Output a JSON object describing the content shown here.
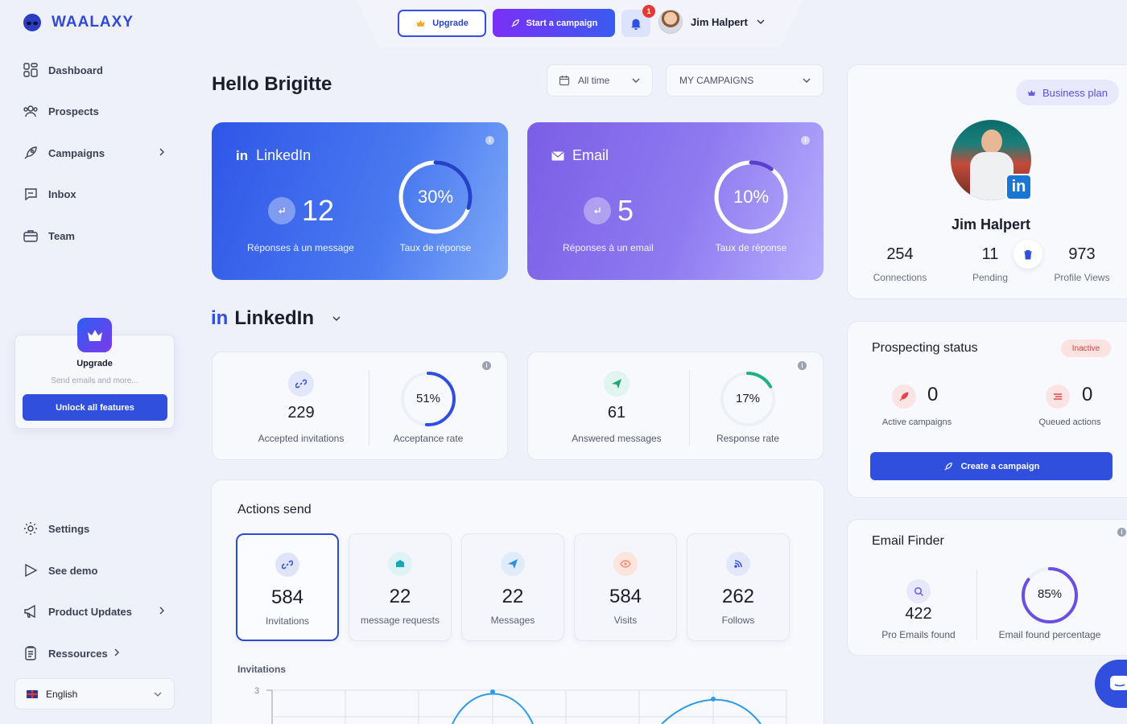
{
  "brand": {
    "name": "WAALAXY"
  },
  "sidebar": {
    "items": [
      {
        "label": "Dashboard",
        "icon": "dashboard-icon"
      },
      {
        "label": "Prospects",
        "icon": "users-icon"
      },
      {
        "label": "Campaigns",
        "icon": "rocket-icon"
      },
      {
        "label": "Inbox",
        "icon": "chat-icon"
      },
      {
        "label": "Team",
        "icon": "briefcase-icon"
      }
    ],
    "bottom_items": [
      {
        "label": "Settings",
        "icon": "gear-icon"
      },
      {
        "label": "See demo",
        "icon": "play-icon"
      },
      {
        "label": "Product Updates",
        "icon": "megaphone-icon"
      },
      {
        "label": "Ressources",
        "icon": "clipboard-icon"
      }
    ],
    "upgrade_card": {
      "title": "Upgrade",
      "subtitle": "Send emails and more...",
      "button": "Unlock all features"
    },
    "language": "English"
  },
  "header": {
    "upgrade_label": "Upgrade",
    "start_campaign_label": "Start a campaign",
    "notification_count": "1",
    "user_name": "Jim Halpert"
  },
  "main": {
    "greeting": "Hello Brigitte",
    "filters": {
      "period": "All time",
      "campaigns": "MY CAMPAIGNS"
    },
    "summary": {
      "linkedin": {
        "title": "LinkedIn",
        "count": "12",
        "count_label": "Réponses à un message",
        "rate": "30%",
        "rate_value": 0.3,
        "rate_label": "Taux de réponse"
      },
      "email": {
        "title": "Email",
        "count": "5",
        "count_label": "Réponses à un email",
        "rate": "10%",
        "rate_value": 0.1,
        "rate_label": "Taux de réponse"
      }
    },
    "section_title": "LinkedIn",
    "stats": {
      "invitations": {
        "value": "229",
        "label": "Accepted invitations",
        "rate": "51%",
        "rate_value": 0.51,
        "rate_label": "Acceptance rate"
      },
      "messages": {
        "value": "61",
        "label": "Answered messages",
        "rate": "17%",
        "rate_value": 0.17,
        "rate_label": "Response rate"
      }
    },
    "actions": {
      "title": "Actions send",
      "tiles": [
        {
          "value": "584",
          "label": "Invitations"
        },
        {
          "value": "22",
          "label": "message requests"
        },
        {
          "value": "22",
          "label": "Messages"
        },
        {
          "value": "584",
          "label": "Visits"
        },
        {
          "value": "262",
          "label": "Follows"
        }
      ],
      "chart_title": "Invitations"
    }
  },
  "chart_data": {
    "type": "line",
    "title": "Invitations",
    "y_ticks": [
      "3"
    ],
    "ylim": [
      0,
      3
    ],
    "grid": true
  },
  "profile": {
    "plan": "Business plan",
    "name": "Jim Halpert",
    "stats": [
      {
        "value": "254",
        "label": "Connections"
      },
      {
        "value": "11",
        "label": "Pending"
      },
      {
        "value": "973",
        "label": "Profile Views"
      }
    ]
  },
  "prospecting": {
    "title": "Prospecting status",
    "status": "Inactive",
    "active": {
      "value": "0",
      "label": "Active campaigns"
    },
    "queued": {
      "value": "0",
      "label": "Queued actions"
    },
    "button": "Create a campaign"
  },
  "email_finder": {
    "title": "Email Finder",
    "found": {
      "value": "422",
      "label": "Pro Emails found"
    },
    "percentage": {
      "value": "85%",
      "value_num": 0.85,
      "label": "Email found percentage"
    }
  },
  "colors": {
    "primary": "#2f4fdc",
    "accent_purple": "#7b2ff7",
    "inactive_badge": "#fde2e2"
  }
}
